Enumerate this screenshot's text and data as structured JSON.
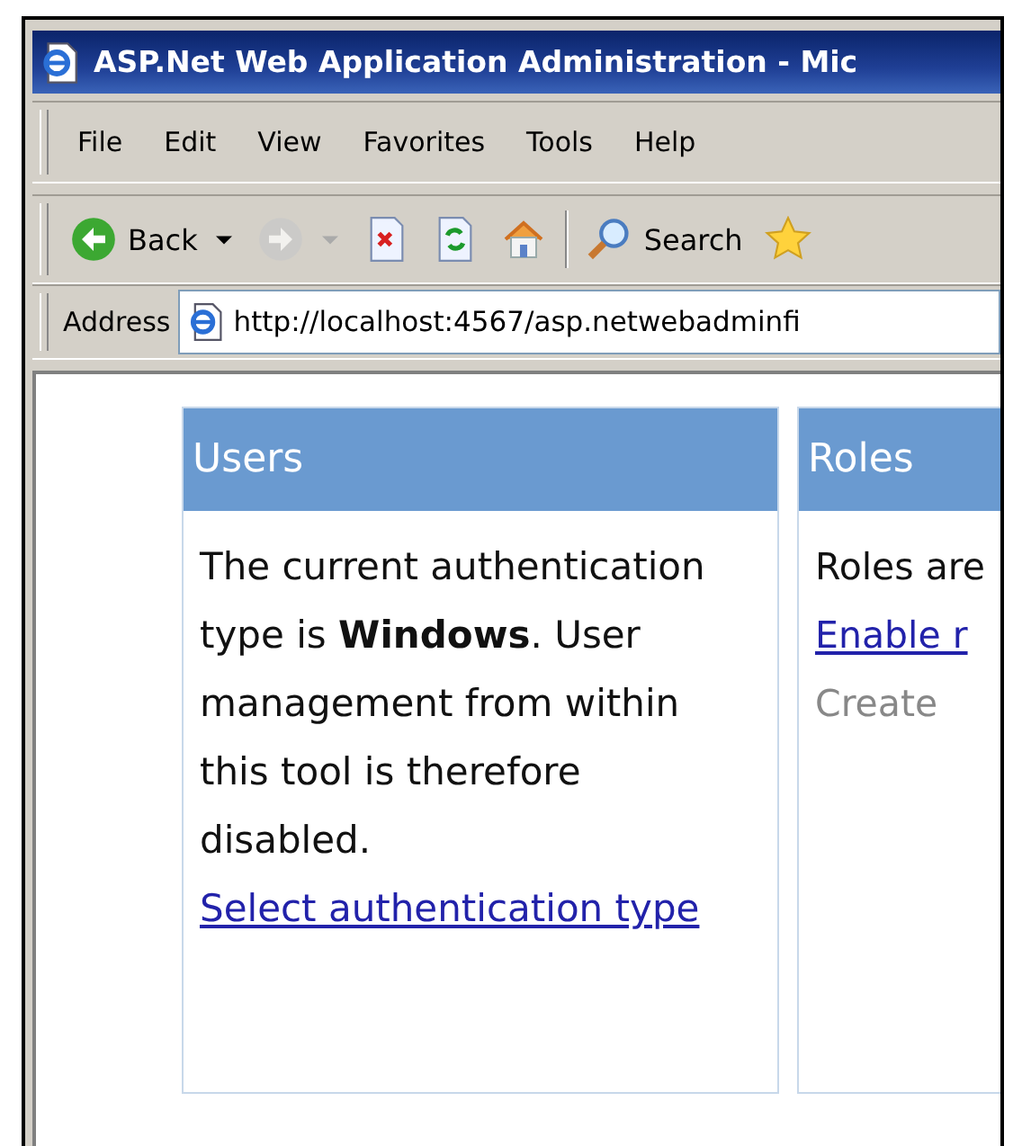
{
  "window": {
    "title": "ASP.Net Web Application Administration - Mic"
  },
  "menu": [
    {
      "label": "File"
    },
    {
      "label": "Edit"
    },
    {
      "label": "View"
    },
    {
      "label": "Favorites"
    },
    {
      "label": "Tools"
    },
    {
      "label": "Help"
    }
  ],
  "toolbar": [
    {
      "kind": "back",
      "label": "Back",
      "disabled": false,
      "dropdown": true
    },
    {
      "kind": "forward",
      "disabled": true,
      "dropdown": true
    },
    {
      "kind": "stop",
      "disabled": false
    },
    {
      "kind": "refresh",
      "disabled": false
    },
    {
      "kind": "home",
      "disabled": false
    },
    {
      "kind": "separator"
    },
    {
      "kind": "search",
      "label": "Search",
      "disabled": false
    },
    {
      "kind": "favorites",
      "disabled": false
    }
  ],
  "address": {
    "label": "Address",
    "value": "http://localhost:4567/asp.netwebadminfi"
  },
  "panels": [
    {
      "title": "Users",
      "lines": [
        {
          "kind": "text",
          "text": "The current authentication type is **Windows**. User management from within this tool is therefore disabled."
        },
        {
          "kind": "link",
          "text": "Select authentication type"
        }
      ]
    },
    {
      "title": "Roles",
      "lines": [
        {
          "kind": "text",
          "text": "Roles are"
        },
        {
          "kind": "link",
          "text": "Enable r"
        },
        {
          "kind": "disabled",
          "text": "Create"
        }
      ]
    }
  ]
}
